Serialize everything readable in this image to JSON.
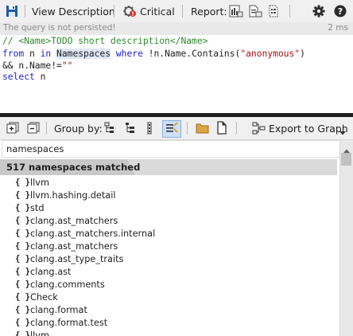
{
  "toolbar": {
    "view_description_label": "View Description",
    "critical_label": "Critical",
    "report_label": "Report:"
  },
  "status": {
    "message": "The query is not persisted!",
    "time": "2 ms"
  },
  "editor": {
    "line1": "// <Name>TODO short description</Name>",
    "line2_a": "from",
    "line2_b": " n ",
    "line2_c": "in",
    "line2_d": " ",
    "line2_e": "Namespaces",
    "line2_f": " ",
    "line2_g": "where",
    "line2_h": " !n.Name.Contains(",
    "line2_i": "\"anonymous\"",
    "line2_j": ")",
    "line3_a": "&& n.Name!=",
    "line3_b": "\"\"",
    "line4_a": "select",
    "line4_b": " n"
  },
  "results_toolbar": {
    "group_by_label": "Group by:",
    "export_label": "Export to Graph"
  },
  "search": {
    "value": "namespaces"
  },
  "matched_label": "517 namespaces matched",
  "list_icon_text": "{ }",
  "rows": [
    "llvm",
    "llvm.hashing.detail",
    "std",
    "clang.ast_matchers",
    "clang.ast_matchers.internal",
    "clang.ast_matchers",
    "clang.ast_type_traits",
    "clang.ast",
    "clang.comments",
    "Check",
    "clang.format",
    "clang.format.test",
    "llvm"
  ],
  "colors": {
    "comment": "#2e8b2e",
    "keyword": "#1f1fd1",
    "string": "#a31515",
    "accent_blue": "#1e5aa8",
    "critical_red": "#d83a2e"
  }
}
